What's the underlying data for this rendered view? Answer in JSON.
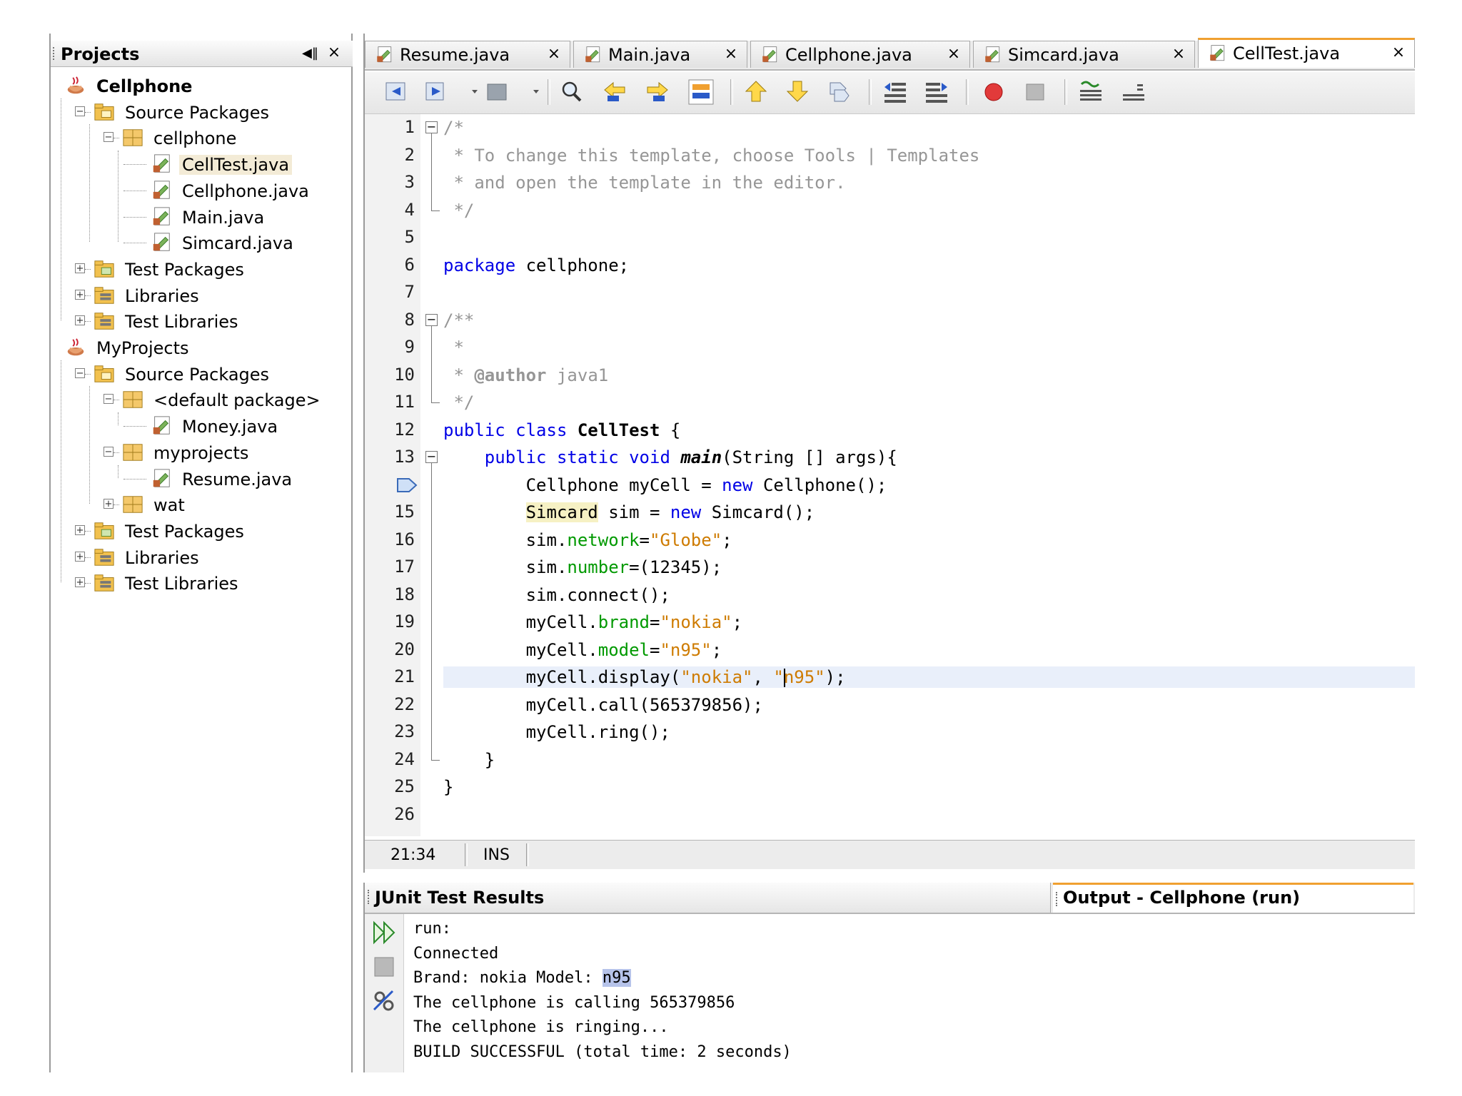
{
  "projects_panel": {
    "title": "Projects",
    "minimize_icon": "◀‖",
    "close_icon": "×",
    "tree": [
      {
        "label": "Cellphone",
        "depth": 0,
        "icon": "java-project-icon",
        "bold": true,
        "expander": ""
      },
      {
        "label": "Source Packages",
        "depth": 1,
        "icon": "source-packages-icon",
        "expander": "−"
      },
      {
        "label": "cellphone",
        "depth": 2,
        "icon": "package-icon",
        "expander": "−"
      },
      {
        "label": "CellTest.java",
        "depth": 3,
        "icon": "java-file-icon",
        "selected": true,
        "expander": ""
      },
      {
        "label": "Cellphone.java",
        "depth": 3,
        "icon": "java-file-icon",
        "expander": ""
      },
      {
        "label": "Main.java",
        "depth": 3,
        "icon": "java-file-icon",
        "expander": ""
      },
      {
        "label": "Simcard.java",
        "depth": 3,
        "icon": "java-file-icon",
        "expander": ""
      },
      {
        "label": "Test Packages",
        "depth": 1,
        "icon": "test-packages-icon",
        "expander": "+"
      },
      {
        "label": "Libraries",
        "depth": 1,
        "icon": "libraries-icon",
        "expander": "+"
      },
      {
        "label": "Test Libraries",
        "depth": 1,
        "icon": "libraries-icon",
        "expander": "+"
      },
      {
        "label": "MyProjects",
        "depth": 0,
        "icon": "java-project-icon",
        "expander": ""
      },
      {
        "label": "Source Packages",
        "depth": 1,
        "icon": "source-packages-icon",
        "expander": "−"
      },
      {
        "label": "<default package>",
        "depth": 2,
        "icon": "package-icon",
        "expander": "−"
      },
      {
        "label": "Money.java",
        "depth": 3,
        "icon": "java-file-icon",
        "expander": ""
      },
      {
        "label": "myprojects",
        "depth": 2,
        "icon": "package-icon",
        "expander": "−"
      },
      {
        "label": "Resume.java",
        "depth": 3,
        "icon": "java-file-icon",
        "expander": ""
      },
      {
        "label": "wat",
        "depth": 2,
        "icon": "package-icon",
        "expander": "+"
      },
      {
        "label": "Test Packages",
        "depth": 1,
        "icon": "test-packages-icon",
        "expander": "+"
      },
      {
        "label": "Libraries",
        "depth": 1,
        "icon": "libraries-icon",
        "expander": "+"
      },
      {
        "label": "Test Libraries",
        "depth": 1,
        "icon": "libraries-icon",
        "expander": "+"
      }
    ]
  },
  "editor": {
    "tabs": [
      {
        "label": "Resume.java",
        "close": "×",
        "active": false
      },
      {
        "label": "Main.java",
        "close": "×",
        "active": false
      },
      {
        "label": "Cellphone.java",
        "close": "×",
        "active": false
      },
      {
        "label": "Simcard.java",
        "close": "×",
        "active": false
      },
      {
        "label": "CellTest.java",
        "close": "×",
        "active": true
      }
    ],
    "toolbar_icons": [
      "back-icon",
      "forward-icon",
      "dropdown-arrow-icon",
      "history-icon",
      "dropdown-arrow-icon",
      "find-icon",
      "find-previous-icon",
      "find-next-icon",
      "toggle-highlight-icon",
      "previous-bookmark-icon",
      "next-bookmark-icon",
      "toggle-bookmark-icon",
      "shift-left-icon",
      "shift-right-icon",
      "start-macro-icon",
      "stop-macro-icon",
      "comment-icon",
      "uncomment-icon"
    ],
    "line_numbers": [
      "1",
      "2",
      "3",
      "4",
      "5",
      "6",
      "7",
      "8",
      "9",
      "10",
      "11",
      "12",
      "13",
      "",
      "15",
      "16",
      "17",
      "18",
      "19",
      "20",
      "21",
      "22",
      "23",
      "24",
      "25",
      "26"
    ],
    "code_lines": [
      "/*",
      " * To change this template, choose Tools | Templates",
      " * and open the template in the editor.",
      " */",
      "",
      "package cellphone;",
      "",
      "/**",
      " *",
      " * @author java1",
      " */",
      "public class CellTest {",
      "    public static void main(String [] args){",
      "        Cellphone myCell = new Cellphone();",
      "        Simcard sim = new Simcard();",
      "        sim.network=\"Globe\";",
      "        sim.number=(12345);",
      "        sim.connect();",
      "        myCell.brand=\"nokia\";",
      "        myCell.model=\"n95\";",
      "        myCell.display(\"nokia\", \"n95\");",
      "        myCell.call(565379856);",
      "        myCell.ring();",
      "    }",
      "}",
      ""
    ],
    "current_line": 21,
    "status": {
      "position": "21:34",
      "mode": "INS"
    }
  },
  "output_panel": {
    "junit_tab_label": "JUnit Test Results",
    "output_tab_label": "Output - Cellphone (run)",
    "side_buttons": [
      "rerun-icon",
      "stop-icon",
      "settings-icon"
    ],
    "lines": [
      "run:",
      "Connected",
      "Brand: nokia Model: n95",
      "The cellphone is calling 565379856",
      "The cellphone is ringing...",
      "BUILD SUCCESSFUL (total time: 2 seconds)"
    ],
    "selected_text": "n95"
  }
}
